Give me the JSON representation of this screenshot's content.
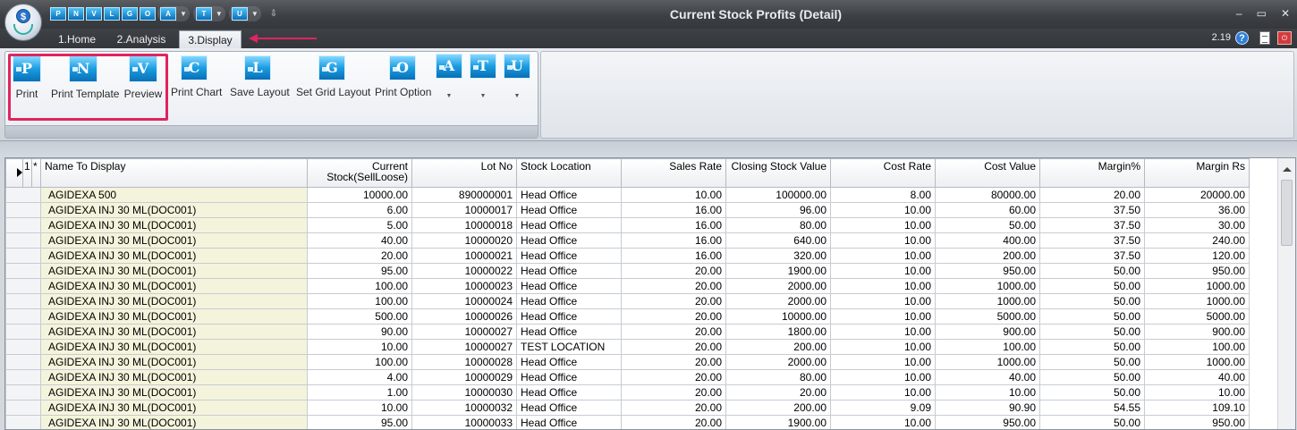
{
  "window": {
    "title": "Current Stock Profits (Detail)",
    "version": "2.19",
    "minimize_glyph": "–",
    "maximize_glyph": "▭",
    "close_glyph": "✕",
    "help_glyph": "?",
    "exit_glyph": "⏻",
    "app_glyph": "$"
  },
  "quick_access": [
    "P",
    "N",
    "V",
    "L",
    "G",
    "O",
    "A",
    "T",
    "U"
  ],
  "tabs": [
    {
      "label": "1.Home"
    },
    {
      "label": "2.Analysis"
    },
    {
      "label": "3.Display",
      "active": true
    }
  ],
  "ribbon": {
    "buttons": [
      {
        "letter": "P",
        "label": "Print"
      },
      {
        "letter": "N",
        "label": "Print Template"
      },
      {
        "letter": "V",
        "label": "Preview"
      },
      {
        "letter": "C",
        "label": "Print Chart"
      },
      {
        "letter": "L",
        "label": "Save Layout"
      },
      {
        "letter": "G",
        "label": "Set Grid Layout"
      },
      {
        "letter": "O",
        "label": "Print Option"
      },
      {
        "letter": "A",
        "label": ""
      },
      {
        "letter": "T",
        "label": ""
      },
      {
        "letter": "U",
        "label": ""
      }
    ]
  },
  "grid": {
    "row_header_labels": [
      "1",
      "*"
    ],
    "columns": [
      "Name To Display",
      "Current Stock(SellLoose)",
      "Lot No",
      "Stock Location",
      "Sales Rate",
      "Closing Stock Value",
      "Cost Rate",
      "Cost Value",
      "Margin%",
      "Margin Rs"
    ],
    "rows": [
      [
        "AGIDEXA 500",
        "10000.00",
        "890000001",
        "Head Office",
        "10.00",
        "100000.00",
        "8.00",
        "80000.00",
        "20.00",
        "20000.00"
      ],
      [
        "AGIDEXA INJ 30 ML(DOC001)",
        "6.00",
        "10000017",
        "Head Office",
        "16.00",
        "96.00",
        "10.00",
        "60.00",
        "37.50",
        "36.00"
      ],
      [
        "AGIDEXA INJ 30 ML(DOC001)",
        "5.00",
        "10000018",
        "Head Office",
        "16.00",
        "80.00",
        "10.00",
        "50.00",
        "37.50",
        "30.00"
      ],
      [
        "AGIDEXA INJ 30 ML(DOC001)",
        "40.00",
        "10000020",
        "Head Office",
        "16.00",
        "640.00",
        "10.00",
        "400.00",
        "37.50",
        "240.00"
      ],
      [
        "AGIDEXA INJ 30 ML(DOC001)",
        "20.00",
        "10000021",
        "Head Office",
        "16.00",
        "320.00",
        "10.00",
        "200.00",
        "37.50",
        "120.00"
      ],
      [
        "AGIDEXA INJ 30 ML(DOC001)",
        "95.00",
        "10000022",
        "Head Office",
        "20.00",
        "1900.00",
        "10.00",
        "950.00",
        "50.00",
        "950.00"
      ],
      [
        "AGIDEXA INJ 30 ML(DOC001)",
        "100.00",
        "10000023",
        "Head Office",
        "20.00",
        "2000.00",
        "10.00",
        "1000.00",
        "50.00",
        "1000.00"
      ],
      [
        "AGIDEXA INJ 30 ML(DOC001)",
        "100.00",
        "10000024",
        "Head Office",
        "20.00",
        "2000.00",
        "10.00",
        "1000.00",
        "50.00",
        "1000.00"
      ],
      [
        "AGIDEXA INJ 30 ML(DOC001)",
        "500.00",
        "10000026",
        "Head Office",
        "20.00",
        "10000.00",
        "10.00",
        "5000.00",
        "50.00",
        "5000.00"
      ],
      [
        "AGIDEXA INJ 30 ML(DOC001)",
        "90.00",
        "10000027",
        "Head Office",
        "20.00",
        "1800.00",
        "10.00",
        "900.00",
        "50.00",
        "900.00"
      ],
      [
        "AGIDEXA INJ 30 ML(DOC001)",
        "10.00",
        "10000027",
        "TEST LOCATION",
        "20.00",
        "200.00",
        "10.00",
        "100.00",
        "50.00",
        "100.00"
      ],
      [
        "AGIDEXA INJ 30 ML(DOC001)",
        "100.00",
        "10000028",
        "Head Office",
        "20.00",
        "2000.00",
        "10.00",
        "1000.00",
        "50.00",
        "1000.00"
      ],
      [
        "AGIDEXA INJ 30 ML(DOC001)",
        "4.00",
        "10000029",
        "Head Office",
        "20.00",
        "80.00",
        "10.00",
        "40.00",
        "50.00",
        "40.00"
      ],
      [
        "AGIDEXA INJ 30 ML(DOC001)",
        "1.00",
        "10000030",
        "Head Office",
        "20.00",
        "20.00",
        "10.00",
        "10.00",
        "50.00",
        "10.00"
      ],
      [
        "AGIDEXA INJ 30 ML(DOC001)",
        "10.00",
        "10000032",
        "Head Office",
        "20.00",
        "200.00",
        "9.09",
        "90.90",
        "54.55",
        "109.10"
      ],
      [
        "AGIDEXA INJ 30 ML(DOC001)",
        "95.00",
        "10000033",
        "Head Office",
        "20.00",
        "1900.00",
        "10.00",
        "950.00",
        "50.00",
        "950.00"
      ]
    ]
  },
  "icons": {
    "app_orb": "app-logo-icon",
    "help": "help-icon",
    "document": "document-icon",
    "exit": "exit-icon",
    "row_pointer": "row-pointer-icon"
  },
  "colors": {
    "highlight": "#e0245e",
    "name_column_bg": "#f4f4dc",
    "ribbon_icon": "#1b9de2"
  }
}
